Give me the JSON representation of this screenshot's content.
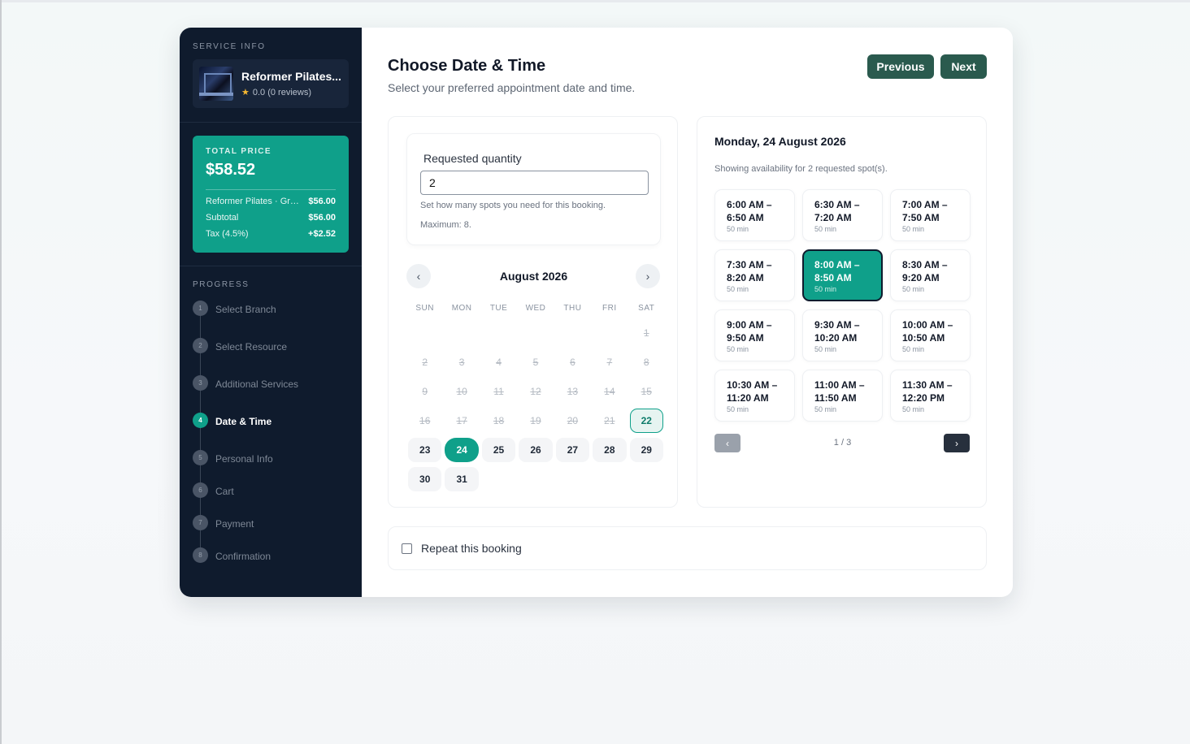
{
  "sidebar": {
    "service_info_label": "SERVICE INFO",
    "service_name": "Reformer Pilates...",
    "service_rating": "0.0 (0 reviews)",
    "total_price_label": "TOTAL PRICE",
    "total_price": "$58.52",
    "line_items": [
      {
        "name": "Reformer Pilates · Gro...",
        "amount": "$56.00"
      },
      {
        "name": "Subtotal",
        "amount": "$56.00"
      },
      {
        "name": "Tax (4.5%)",
        "amount": "+$2.52"
      }
    ],
    "progress_label": "PROGRESS",
    "steps": [
      {
        "num": "1",
        "label": "Select Branch"
      },
      {
        "num": "2",
        "label": "Select Resource"
      },
      {
        "num": "3",
        "label": "Additional Services"
      },
      {
        "num": "4",
        "label": "Date & Time",
        "active": true
      },
      {
        "num": "5",
        "label": "Personal Info"
      },
      {
        "num": "6",
        "label": "Cart"
      },
      {
        "num": "7",
        "label": "Payment"
      },
      {
        "num": "8",
        "label": "Confirmation"
      }
    ]
  },
  "header": {
    "title": "Choose Date & Time",
    "subtitle": "Select your preferred appointment date and time.",
    "previous_label": "Previous",
    "next_label": "Next"
  },
  "quantity": {
    "label": "Requested quantity",
    "value": "2",
    "help": "Set how many spots you need for this booking.",
    "max": "Maximum: 8."
  },
  "calendar": {
    "month_title": "August 2026",
    "weekdays": [
      "SUN",
      "MON",
      "TUE",
      "WED",
      "THU",
      "FRI",
      "SAT"
    ],
    "leading_blanks": 6,
    "days": [
      {
        "d": "1",
        "s": "disabled"
      },
      {
        "d": "2",
        "s": "disabled"
      },
      {
        "d": "3",
        "s": "disabled"
      },
      {
        "d": "4",
        "s": "disabled"
      },
      {
        "d": "5",
        "s": "disabled"
      },
      {
        "d": "6",
        "s": "disabled"
      },
      {
        "d": "7",
        "s": "disabled"
      },
      {
        "d": "8",
        "s": "disabled"
      },
      {
        "d": "9",
        "s": "disabled"
      },
      {
        "d": "10",
        "s": "disabled"
      },
      {
        "d": "11",
        "s": "disabled"
      },
      {
        "d": "12",
        "s": "disabled"
      },
      {
        "d": "13",
        "s": "disabled"
      },
      {
        "d": "14",
        "s": "disabled"
      },
      {
        "d": "15",
        "s": "disabled"
      },
      {
        "d": "16",
        "s": "disabled"
      },
      {
        "d": "17",
        "s": "disabled"
      },
      {
        "d": "18",
        "s": "disabled"
      },
      {
        "d": "19",
        "s": "disabled"
      },
      {
        "d": "20",
        "s": "disabled"
      },
      {
        "d": "21",
        "s": "disabled"
      },
      {
        "d": "22",
        "s": "today"
      },
      {
        "d": "23",
        "s": "avail"
      },
      {
        "d": "24",
        "s": "selected"
      },
      {
        "d": "25",
        "s": "avail"
      },
      {
        "d": "26",
        "s": "avail"
      },
      {
        "d": "27",
        "s": "avail"
      },
      {
        "d": "28",
        "s": "avail"
      },
      {
        "d": "29",
        "s": "avail"
      },
      {
        "d": "30",
        "s": "avail"
      },
      {
        "d": "31",
        "s": "avail"
      }
    ]
  },
  "slots": {
    "date_heading": "Monday, 24 August 2026",
    "info": "Showing availability for 2 requested spot(s).",
    "items": [
      {
        "start": "6:00 AM –",
        "end": "6:50 AM",
        "duration": "50 min"
      },
      {
        "start": "6:30 AM –",
        "end": "7:20 AM",
        "duration": "50 min"
      },
      {
        "start": "7:00 AM –",
        "end": "7:50 AM",
        "duration": "50 min"
      },
      {
        "start": "7:30 AM –",
        "end": "8:20 AM",
        "duration": "50 min"
      },
      {
        "start": "8:00 AM –",
        "end": "8:50 AM",
        "duration": "50 min",
        "selected": true
      },
      {
        "start": "8:30 AM –",
        "end": "9:20 AM",
        "duration": "50 min"
      },
      {
        "start": "9:00 AM –",
        "end": "9:50 AM",
        "duration": "50 min"
      },
      {
        "start": "9:30 AM –",
        "end": "10:20 AM",
        "duration": "50 min"
      },
      {
        "start": "10:00 AM –",
        "end": "10:50 AM",
        "duration": "50 min"
      },
      {
        "start": "10:30 AM –",
        "end": "11:20 AM",
        "duration": "50 min"
      },
      {
        "start": "11:00 AM –",
        "end": "11:50 AM",
        "duration": "50 min"
      },
      {
        "start": "11:30 AM –",
        "end": "12:20 PM",
        "duration": "50 min"
      }
    ],
    "pagination": "1 / 3"
  },
  "repeat": {
    "label": "Repeat this booking",
    "checked": false
  }
}
